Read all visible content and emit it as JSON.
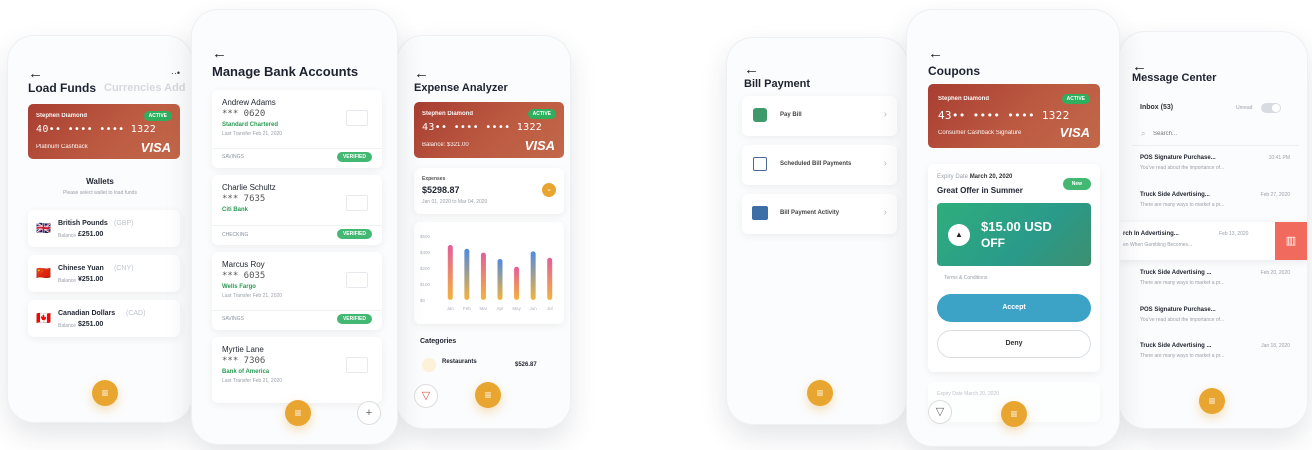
{
  "common": {
    "back_arrow": "←",
    "fab_icon": "≡",
    "visa": "VISA",
    "active": "ACTIVE",
    "holder": "Stephen Diamond"
  },
  "load_funds": {
    "title": "Load Funds",
    "tab2": "Currencies Add",
    "menu_dots": "··•",
    "card_number": "40•• •••• •••• 1322",
    "card_sub": "Platinum Cashback",
    "wallets_title": "Wallets",
    "wallets_sub": "Please select wallet to load funds",
    "balance_label": "Balance",
    "wallets": [
      {
        "name": "British Pounds",
        "code": "(GBP)",
        "amount": "£251.00",
        "flag": "🇬🇧"
      },
      {
        "name": "Chinese Yuan",
        "code": "(CNY)",
        "amount": "¥251.00",
        "flag": "🇨🇳"
      },
      {
        "name": "Canadian Dollars",
        "code": "(CAD)",
        "amount": "$251.00",
        "flag": "🇨🇦"
      }
    ]
  },
  "bank_accounts": {
    "title": "Manage Bank Accounts",
    "verified": "VERIFIED",
    "plus": "+",
    "accounts": [
      {
        "name": "Andrew Adams",
        "number": "*** 0620",
        "bank": "Standard Chartered",
        "transfer": "Last Transfer Feb 21, 2020",
        "type": "SAVINGS"
      },
      {
        "name": "Charlie Schultz",
        "number": "*** 7635",
        "bank": "Citi Bank",
        "transfer": "",
        "type": "CHECKING"
      },
      {
        "name": "Marcus Roy",
        "number": "*** 6035",
        "bank": "Wells Fargo",
        "transfer": "Last Transfer Feb 21, 2020",
        "type": "SAVINGS"
      },
      {
        "name": "Myrtie Lane",
        "number": "*** 7306",
        "bank": "Bank of America",
        "transfer": "Last Transfer Feb 21, 2020",
        "type": ""
      }
    ]
  },
  "expense": {
    "title": "Expense Analyzer",
    "card_number": "43•• •••• •••• 1322",
    "balance": "Balance: $321.00",
    "expenses_label": "Expenses",
    "expenses_value": "$5298.87",
    "expenses_range": "Jan 01, 2020 to Mar 04, 2020",
    "categories": "Categories",
    "cat_name": "Restaurants",
    "cat_amount": "$526.87",
    "chart_data": {
      "type": "bar",
      "categories": [
        "Jan",
        "Feb",
        "Mar",
        "Apr",
        "May",
        "Jun",
        "Jul"
      ],
      "values": [
        430,
        400,
        370,
        320,
        260,
        380,
        330
      ],
      "ylim": [
        0,
        500
      ],
      "yticks": [
        "$500",
        "$400",
        "$200",
        "$100",
        "$0"
      ]
    }
  },
  "bill_payment": {
    "title": "Bill Payment",
    "items": [
      {
        "label": "Pay Bill"
      },
      {
        "label": "Scheduled Bill Payments"
      },
      {
        "label": "Bill Payment Activity"
      }
    ]
  },
  "coupons": {
    "title": "Coupons",
    "card_number": "43•• •••• •••• 1322",
    "card_sub": "Consumer Cashback Signature",
    "expiry_label": "Expiry Date",
    "expiry_date": "March 20, 2020",
    "new_badge": "New",
    "offer_title": "Great Offer in Summer",
    "amount": "$15.00 USD",
    "off": "OFF",
    "terms": "Terms & Conditions",
    "accept": "Accept",
    "deny": "Deny",
    "expiry2": "Expiry Date March 20, 2020"
  },
  "messages": {
    "title": "Message Center",
    "inbox": "Inbox (53)",
    "unread": "Unread",
    "search_placeholder": "Search...",
    "items": [
      {
        "subject": "POS Signature Purchase...",
        "preview": "You've read about the importance of...",
        "time": "10:41 PM"
      },
      {
        "subject": "Truck Side Advertising...",
        "preview": "There are many ways to market a pr...",
        "time": "Feb 27, 2020"
      },
      {
        "subject": "rch In Advertising...",
        "preview": "en When Gambling Becomes...",
        "time": "Feb 13, 2020"
      },
      {
        "subject": "Truck Side Advertising ...",
        "preview": "There are many ways to market a pr...",
        "time": "Feb 20, 2020"
      },
      {
        "subject": "POS Signature Purchase...",
        "preview": "You've read about the importance of...",
        "time": ""
      },
      {
        "subject": "Truck Side Advertising ...",
        "preview": "There are many ways to market a pr...",
        "time": "Jan 18, 2020"
      }
    ]
  }
}
